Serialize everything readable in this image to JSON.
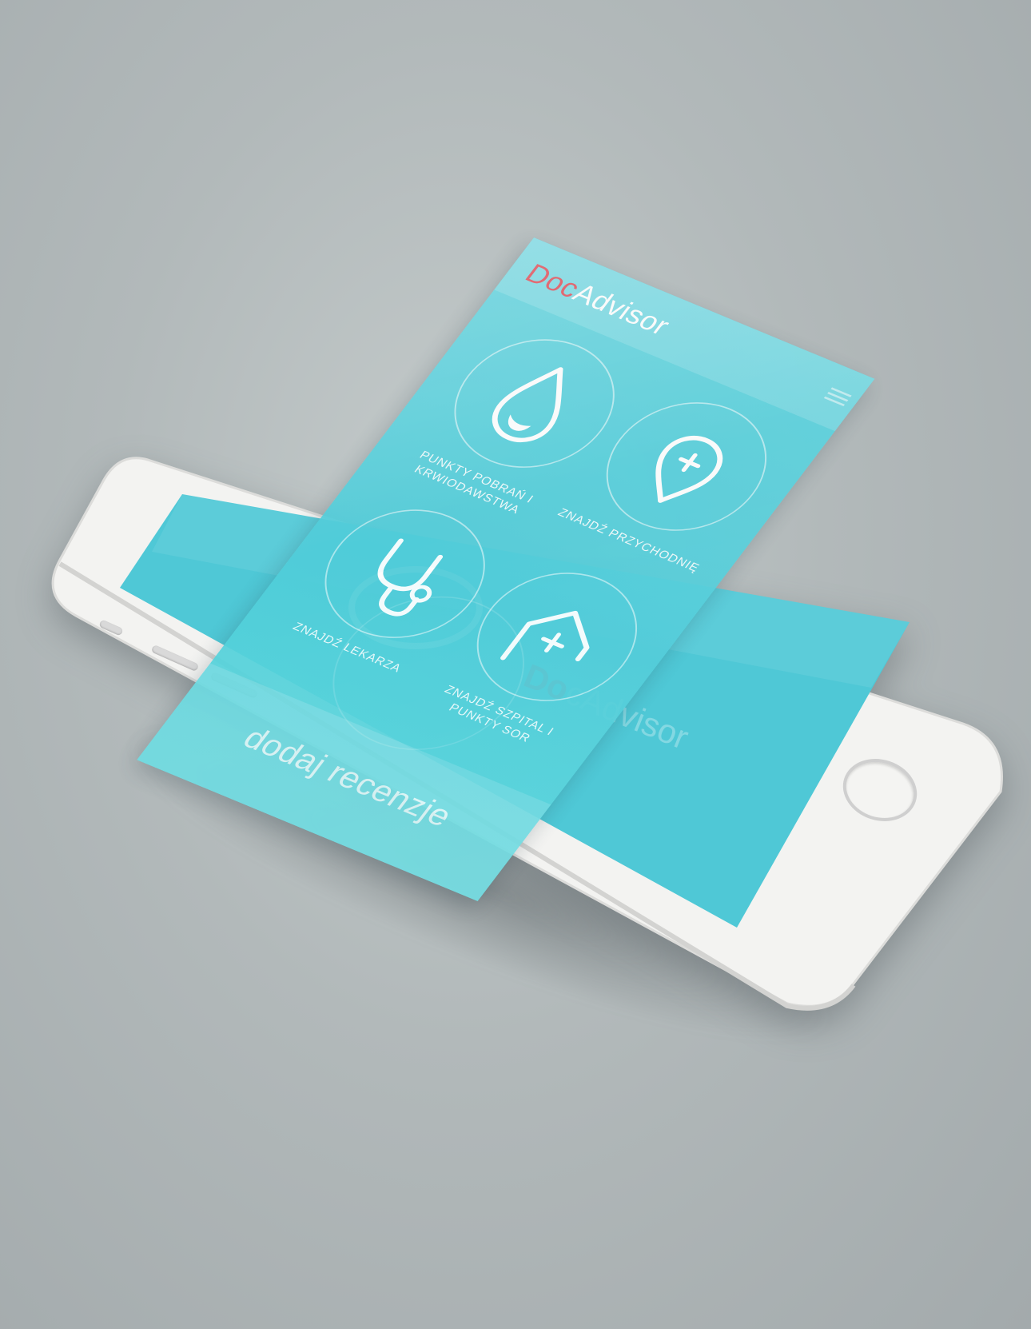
{
  "background": {
    "color": "#b2b9ba"
  },
  "phone": {
    "body_color": "#f3f3f1",
    "screen_color": "#4fc8d6",
    "under_screen_logo": {
      "doc": "Do",
      "rest": "cAdvisor"
    }
  },
  "app": {
    "accent": "#4fccd9",
    "brand_red": "#e04a55",
    "logo": {
      "doc": "Doc",
      "advisor": "Advisor"
    },
    "tiles": [
      {
        "label": "PUNKTY POBRAŃ I KRWIODAWSTWA",
        "icon": "blood-drop-icon"
      },
      {
        "label": "ZNAJDŹ PRZYCHODNIĘ",
        "icon": "medical-pin-icon"
      },
      {
        "label": "ZNAJDŹ LEKARZA",
        "icon": "stethoscope-icon"
      },
      {
        "label": "ZNAJDŹ SZPITAL I PUNKTY SOR",
        "icon": "hospital-icon"
      }
    ],
    "cta": "dodaj recenzje"
  }
}
